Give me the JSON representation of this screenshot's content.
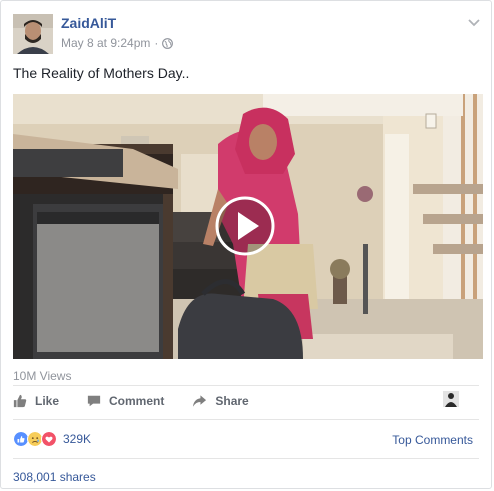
{
  "post": {
    "author": "ZaidAliT",
    "date": "May 8 at 9:24pm",
    "separator": "·",
    "text": "The Reality of Mothers Day..",
    "icons": {
      "privacy": "globe-icon",
      "menu": "chevron-down-icon",
      "play": "play-icon"
    }
  },
  "video": {
    "views": "10M Views"
  },
  "actions": {
    "like": "Like",
    "comment": "Comment",
    "share": "Share"
  },
  "footer": {
    "reaction_count": "329K",
    "top_comments": "Top Comments",
    "shares": "308,001 shares"
  },
  "colors": {
    "link": "#365899",
    "meta": "#90949c",
    "action": "#616770",
    "like_blue": "#5890ff",
    "love_red": "#f25268",
    "sad_yellow": "#f7cd5a"
  }
}
